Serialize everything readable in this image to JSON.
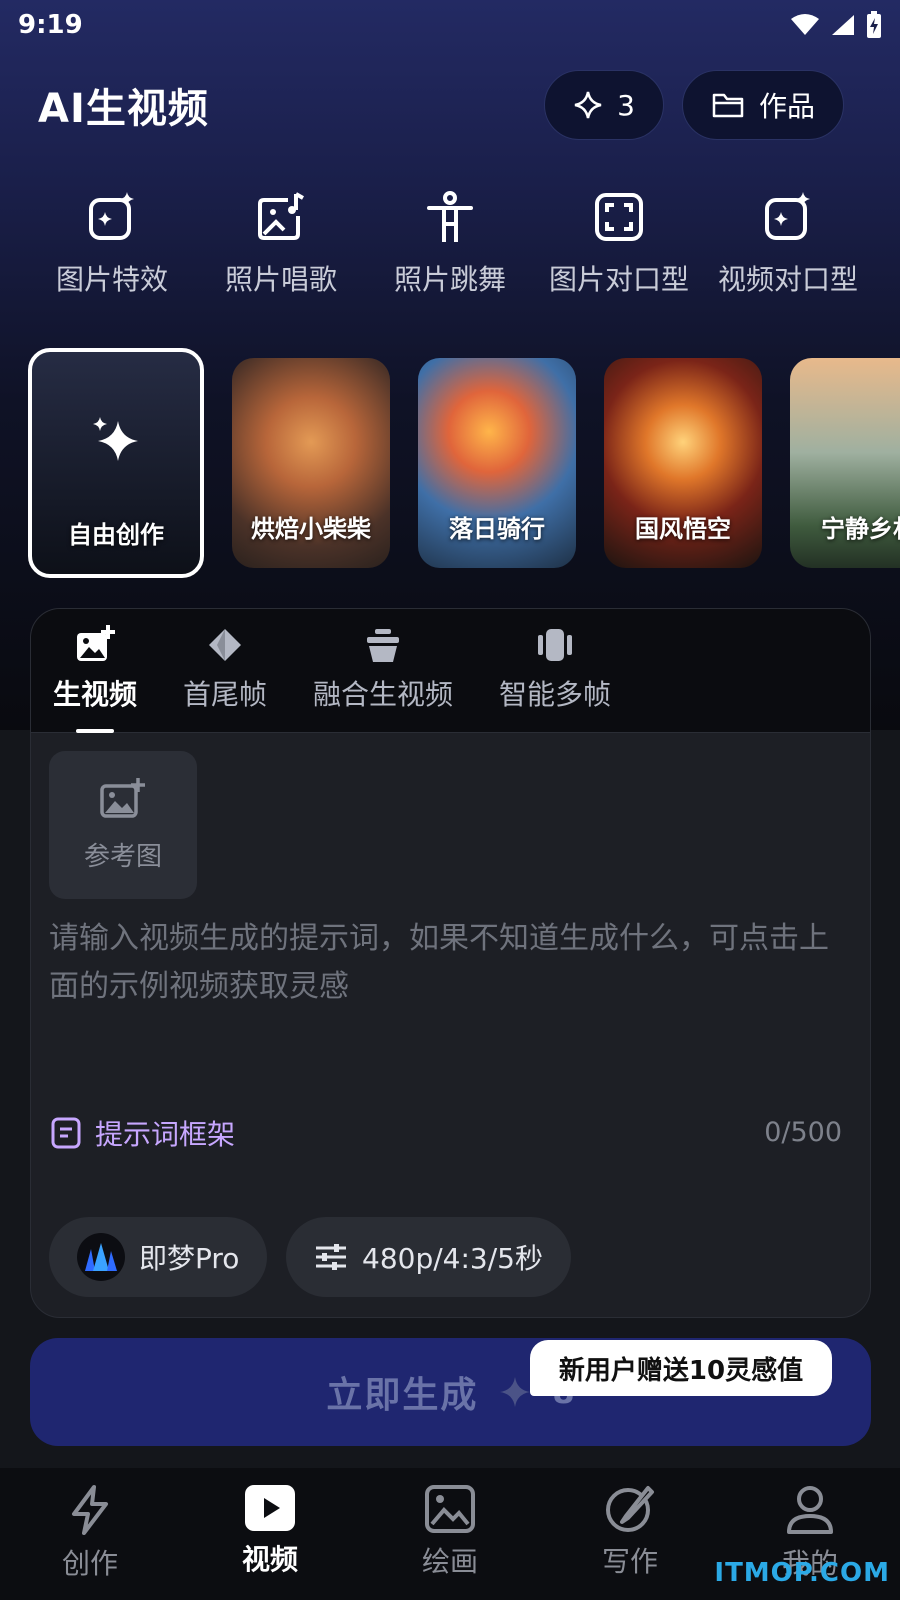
{
  "status": {
    "time": "9:19"
  },
  "header": {
    "title": "AI生视频",
    "credits": "3",
    "works_label": "作品"
  },
  "tools": [
    {
      "label": "图片特效",
      "icon": "sparkle-image-icon"
    },
    {
      "label": "照片唱歌",
      "icon": "music-photo-icon"
    },
    {
      "label": "照片跳舞",
      "icon": "dancer-icon"
    },
    {
      "label": "图片对口型",
      "icon": "frame-icon"
    },
    {
      "label": "视频对口型",
      "icon": "sparkle-video-icon"
    }
  ],
  "samples": [
    {
      "label": "自由创作"
    },
    {
      "label": "烘焙小柴柴"
    },
    {
      "label": "落日骑行"
    },
    {
      "label": "国风悟空"
    },
    {
      "label": "宁静乡村"
    }
  ],
  "panel": {
    "tabs": [
      {
        "label": "生视频",
        "active": true
      },
      {
        "label": "首尾帧",
        "active": false
      },
      {
        "label": "融合生视频",
        "active": false
      },
      {
        "label": "智能多帧",
        "active": false
      }
    ],
    "reference_label": "参考图",
    "prompt_placeholder": "请输入视频生成的提示词，如果不知道生成什么，可点击上面的示例视频获取灵感",
    "prompt_value": "",
    "framework_label": "提示词框架",
    "char_count": "0/500",
    "model_label": "即梦Pro",
    "settings_label": "480p/4:3/5秒"
  },
  "generate": {
    "label": "立即生成",
    "cost": "8",
    "promo": "新用户赠送10灵感值"
  },
  "nav": [
    {
      "label": "创作",
      "icon": "lightning-icon",
      "active": false
    },
    {
      "label": "视频",
      "icon": "play-icon",
      "active": true
    },
    {
      "label": "绘画",
      "icon": "image-icon",
      "active": false
    },
    {
      "label": "写作",
      "icon": "pen-icon",
      "active": false
    },
    {
      "label": "我的",
      "icon": "user-icon",
      "active": false
    }
  ],
  "watermark": "ITMOP.COM",
  "colors": {
    "accent_purple": "#c7a7ff",
    "generate_button": "#1f2670",
    "watermark": "#2ba9e6"
  }
}
